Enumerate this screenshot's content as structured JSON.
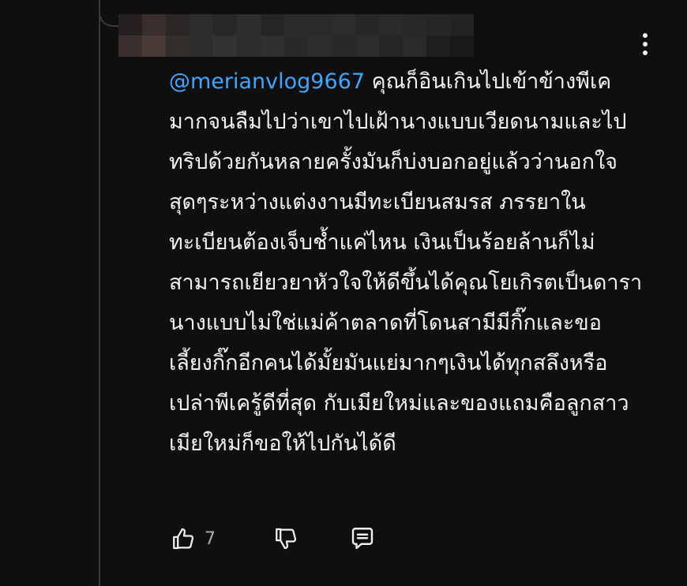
{
  "comment": {
    "author_redacted": true,
    "mention": "@merianvlog9667",
    "text": " คุณก็อินเกินไปเข้าข้างพีเคมากจนลืมไปว่าเขาไปเฝ้านางแบบเวียดนามและไปทริปด้วยกันหลายครั้งมันก็บ่งบอกอยู่แล้วว่านอกใจสุดๆระหว่างแต่งงานมีทะเบียนสมรส ภรรยาในทะเบียนต้องเจ็บช้ำแค่ไหน เงินเป็นร้อยล้านก็ไม่สามารถเยียวยาหัวใจให้ดีขึ้นได้คุณโยเกิรตเป็นดารานางแบบไม่ใช่แม่ค้าตลาดที่โดนสามีมีกิ๊กและขอเลี้ยงกิ๊กอีกคนได้มั้ยมันแย่มากๆเงินได้ทุกสลึงหรือเปล่าพีเครู้ดีที่สุด กับเมียใหม่และของแถมคือลูกสาวเมียใหม่ก็ขอให้ไปกันได้ดี",
    "like_count": "7"
  },
  "icons": {
    "more": "more-vertical-icon",
    "like": "thumbs-up-icon",
    "dislike": "thumbs-down-icon",
    "reply": "reply-comment-icon"
  },
  "colors": {
    "background": "#0f0f0f",
    "text": "#f1f1f1",
    "mention": "#3ea6ff",
    "secondary": "#aaaaaa"
  }
}
